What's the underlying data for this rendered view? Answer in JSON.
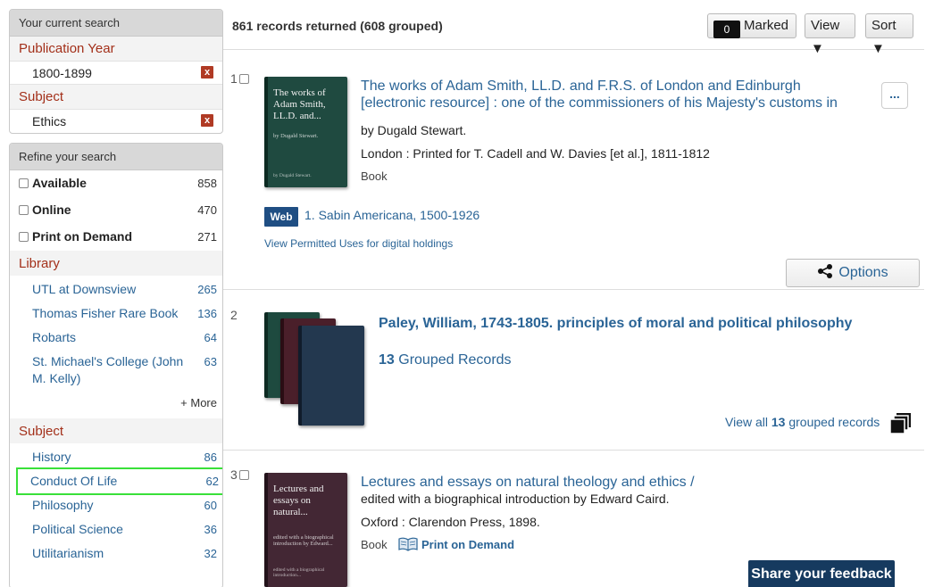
{
  "current_search": {
    "heading": "Your current search",
    "filters": [
      {
        "category": "Publication Year",
        "value": "1800-1899",
        "remove": "x"
      },
      {
        "category": "Subject",
        "value": "Ethics",
        "remove": "x"
      }
    ]
  },
  "refine": {
    "heading": "Refine your search",
    "availability": [
      {
        "label": "Available",
        "count": "858"
      },
      {
        "label": "Online",
        "count": "470"
      },
      {
        "label": "Print on Demand",
        "count": "271"
      }
    ],
    "library": {
      "heading": "Library",
      "items": [
        {
          "label": "UTL at Downsview",
          "count": "265"
        },
        {
          "label": "Thomas Fisher Rare Book",
          "count": "136"
        },
        {
          "label": "Robarts",
          "count": "64"
        },
        {
          "label": "St. Michael's College (John M. Kelly)",
          "count": "63"
        }
      ],
      "more": "+ More"
    },
    "subject": {
      "heading": "Subject",
      "items": [
        {
          "label": "History",
          "count": "86"
        },
        {
          "label": "Conduct Of Life",
          "count": "62"
        },
        {
          "label": "Philosophy",
          "count": "60"
        },
        {
          "label": "Political Science",
          "count": "36"
        },
        {
          "label": "Utilitarianism",
          "count": "32"
        }
      ]
    }
  },
  "toolbar": {
    "records_text": "861 records returned (608 grouped)",
    "marked_count": "0",
    "marked_label": "Marked",
    "view_label": "View ▼",
    "sort_label": "Sort ▼"
  },
  "records": [
    {
      "num": "1",
      "cover_title": "The works of Adam Smith, LL.D. and...",
      "cover_sub": "by Dugald Stewart.",
      "cover_sub2": "by Dugald Stewart.",
      "title_line1": "The works of Adam Smith, LL.D. and F.R.S. of London and Edinburgh",
      "title_line2": "[electronic resource] : one of the commissioners of his Majesty's customs in",
      "author": "by Dugald Stewart.",
      "publisher": "London : Printed for T. Cadell and W. Davies [et al.], 1811-1812",
      "type": "Book",
      "more_label": "...",
      "web_badge": "Web",
      "web_link": "1. Sabin Americana, 1500-1926",
      "permitted_link": "View Permitted Uses for digital holdings",
      "options_label": "Options"
    },
    {
      "num": "2",
      "title": "Paley, William, 1743-1805. principles of moral and political philosophy",
      "grouped_count": "13",
      "grouped_label": "Grouped Records",
      "view_all_prefix": "View all",
      "view_all_suffix": "grouped records"
    },
    {
      "num": "3",
      "cover_title": "Lectures and essays on natural...",
      "cover_sub": "edited with a biographical introduction by Edward...",
      "cover_sub2": "edited with a biographical introduction...",
      "title": "Lectures and essays on natural theology and ethics /",
      "editor": "edited with a biographical introduction by Edward Caird.",
      "publisher": "Oxford : Clarendon Press, 1898.",
      "type": "Book",
      "pod_label": "Print on Demand"
    }
  ],
  "feedback": {
    "label": "Share your feedback"
  },
  "colors": {
    "link": "#2a6496",
    "facet_heading": "#a3301a",
    "remove": "#b03a24",
    "web_badge": "#1f4e83",
    "highlight": "#39e039",
    "feedback_bg": "#163a5f"
  }
}
